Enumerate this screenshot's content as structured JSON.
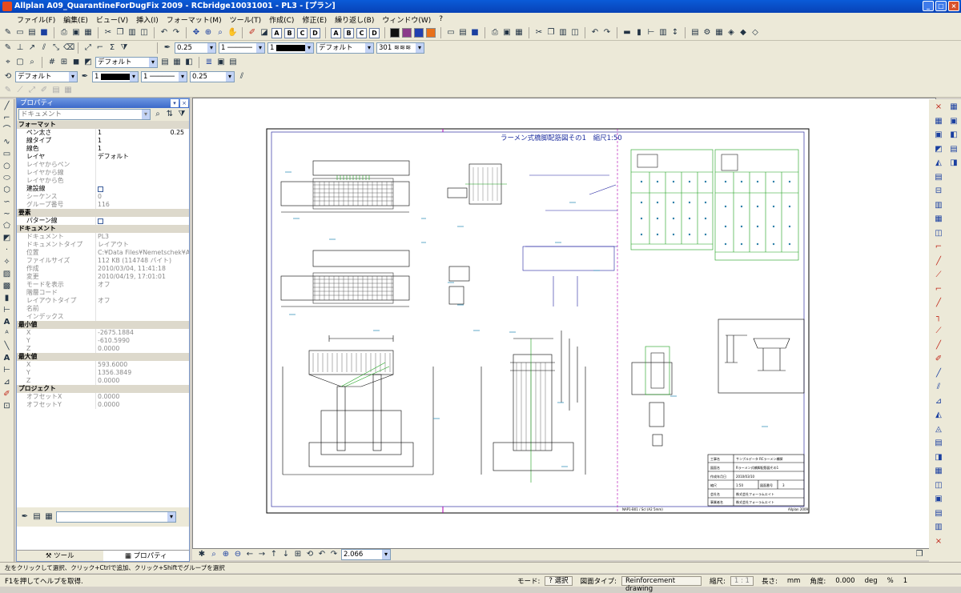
{
  "window": {
    "title": "Allplan A09_QuarantineForDugFix 2009 - RCbridge10031001 - PL3 - [プラン]"
  },
  "menu": [
    "ファイル(F)",
    "編集(E)",
    "ビュー(V)",
    "挿入(I)",
    "フォーマット(M)",
    "ツール(T)",
    "作成(C)",
    "修正(E)",
    "繰り返し(B)",
    "ウィンドウ(W)",
    "?"
  ],
  "toolbar": {
    "letters": [
      "A",
      "B",
      "C",
      "D"
    ],
    "letters2": [
      "A",
      "B",
      "C",
      "D"
    ],
    "swatch_colors": [
      "#101010",
      "#8a3a8a",
      "#2040b0",
      "#e8701a"
    ],
    "pen_value": "0.25",
    "line_value": "1",
    "color_value": "1",
    "style_value": "デフォルト",
    "hatch_value": "301",
    "format_value": "デフォルト",
    "layer_value": "デフォルト",
    "pen2_value": "1",
    "line2_value": "1",
    "pen3_value": "0.25"
  },
  "props": {
    "title": "プロパティ",
    "doc_select": "ドキュメント",
    "sections": [
      {
        "label": "フォーマット",
        "rows": [
          {
            "k": "ペン太さ",
            "v": "1",
            "extra": "0.25"
          },
          {
            "k": "線タイプ",
            "v": "1"
          },
          {
            "k": "線色",
            "v": "1"
          },
          {
            "k": "レイヤ",
            "v": "デフォルト"
          },
          {
            "k": "レイヤからペン",
            "v": "",
            "dis": true
          },
          {
            "k": "レイヤから線",
            "v": "",
            "dis": true
          },
          {
            "k": "レイヤから色",
            "v": "",
            "dis": true
          },
          {
            "k": "建設線",
            "v": ""
          },
          {
            "k": "シーケンス",
            "v": "0",
            "dis": true
          },
          {
            "k": "グループ番号",
            "v": "116",
            "dis": true
          }
        ]
      },
      {
        "label": "要素",
        "rows": [
          {
            "k": "パターン線",
            "v": ""
          }
        ]
      },
      {
        "label": "ドキュメント",
        "rows": [
          {
            "k": "ドキュメント",
            "v": "PL3",
            "dis": true
          },
          {
            "k": "ドキュメントタイプ",
            "v": "レイアウト",
            "dis": true
          },
          {
            "k": "位置",
            "v": "C:¥Data Files¥Nemetschek¥A09",
            "dis": true
          },
          {
            "k": "ファイルサイズ",
            "v": "112 KB (114748 バイト)",
            "dis": true
          },
          {
            "k": "作成",
            "v": "2010/03/04, 11:41:18",
            "dis": true
          },
          {
            "k": "変更",
            "v": "2010/04/19, 17:01:01",
            "dis": true
          },
          {
            "k": "モードを表示",
            "v": "オフ",
            "dis": true
          },
          {
            "k": "階層コード",
            "v": "",
            "dis": true
          },
          {
            "k": "レイアウトタイプ",
            "v": "オフ",
            "dis": true
          },
          {
            "k": "名前",
            "v": "",
            "dis": true
          },
          {
            "k": "インデックス",
            "v": "",
            "dis": true
          }
        ]
      },
      {
        "label": "最小値",
        "rows": [
          {
            "k": "X",
            "v": "-2675.1884",
            "dis": true
          },
          {
            "k": "Y",
            "v": "-610.5990",
            "dis": true
          },
          {
            "k": "Z",
            "v": "0.0000",
            "dis": true
          }
        ]
      },
      {
        "label": "最大値",
        "rows": [
          {
            "k": "X",
            "v": "593.6000",
            "dis": true
          },
          {
            "k": "Y",
            "v": "1356.3849",
            "dis": true
          },
          {
            "k": "Z",
            "v": "0.0000",
            "dis": true
          }
        ]
      },
      {
        "label": "プロジェクト",
        "rows": [
          {
            "k": "オフセットX",
            "v": "0.0000",
            "dis": true
          },
          {
            "k": "オフセットY",
            "v": "0.0000",
            "dis": true
          },
          {
            "k": "オフセットZ",
            "v": "0.0000",
            "dis": true
          }
        ]
      }
    ],
    "tab_tools": "ツール",
    "tab_props": "プロパティ"
  },
  "drawing": {
    "sheet_title": "ラーメン式橋脚配筋図その1　縮尺1:50",
    "titleblock": [
      {
        "k": "工事名",
        "v": "サンプルデータ RCラーメン橋脚"
      },
      {
        "k": "図面名",
        "v": "Rラーメン式橋脚配筋図その1"
      },
      {
        "k": "作成年月日",
        "v": "2010/03/10"
      },
      {
        "k": "縮尺",
        "v": "1:50",
        "k2": "図面番号",
        "v2": "3"
      },
      {
        "k": "会社名",
        "v": "株式会社フォーラムエイト"
      },
      {
        "k": "事業者名",
        "v": "株式会社フォーラムエイト"
      }
    ],
    "footer_text": "NAP1-B01 / Scl (A2 5mm)",
    "footer_brand": "Allplan 2009"
  },
  "navbar": {
    "zoom": "2.066"
  },
  "hint": "左をクリックして選択、クリック+Ctrlで追加、クリック+Shiftでグループを選択",
  "status": {
    "help": "F1を押してヘルプを取得.",
    "mode_label": "モード:",
    "mode_value": "? 選択",
    "type_label": "図面タイプ:",
    "type_value": "Reinforcement drawing",
    "scale_label": "縮尺:",
    "scale_value": "1 : 1",
    "length_label": "長さ:",
    "length_value": "mm",
    "angle_label": "角度:",
    "angle_value": "0.000",
    "deg_label": "deg",
    "percent_label": "%",
    "percent_value": "1"
  }
}
